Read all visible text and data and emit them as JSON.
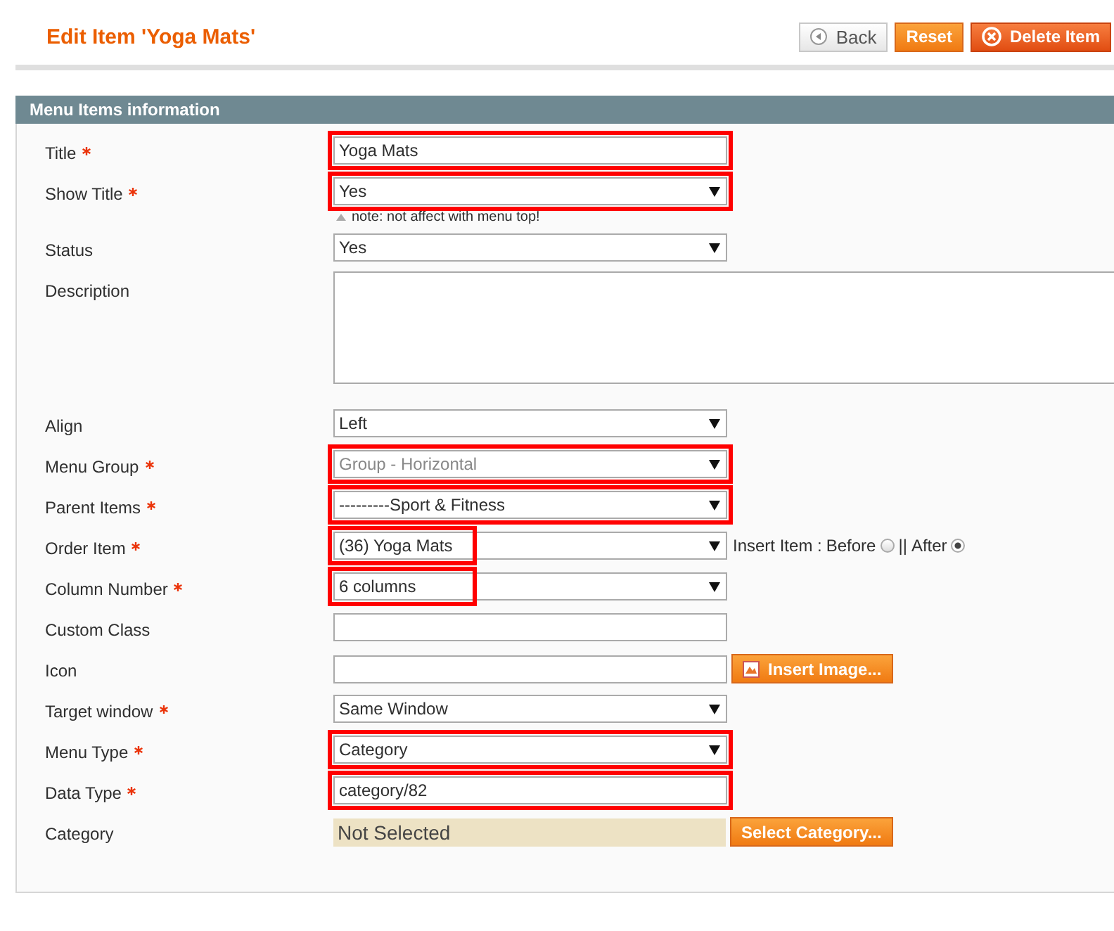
{
  "page_title": "Edit Item 'Yoga Mats'",
  "header_buttons": [
    {
      "label": "Back",
      "kind": "back"
    },
    {
      "label": "Reset",
      "kind": "primary"
    },
    {
      "label": "Delete Item",
      "kind": "delete"
    }
  ],
  "section": {
    "title": "Menu Items information"
  },
  "fields": [
    {
      "label": "Title",
      "required": true,
      "kind": "text",
      "value": "Yoga Mats",
      "highlighted": true
    },
    {
      "label": "Show Title",
      "required": true,
      "kind": "select",
      "value": "Yes",
      "highlighted": true,
      "note": "note: not affect with menu top!"
    },
    {
      "label": "Status",
      "required": false,
      "kind": "select",
      "value": "Yes"
    },
    {
      "label": "Description",
      "required": false,
      "kind": "textarea"
    },
    {
      "label": "Align",
      "required": false,
      "kind": "select",
      "value": "Left"
    },
    {
      "label": "Menu Group",
      "required": true,
      "kind": "select",
      "value": "Group - Horizontal",
      "disabled": true,
      "highlighted": true
    },
    {
      "label": "Parent Items",
      "required": true,
      "kind": "select",
      "value": "---------Sport & Fitness",
      "highlighted": true
    },
    {
      "label": "Order Item",
      "required": true,
      "kind": "select",
      "value": "(36) Yoga Mats",
      "highlighted": true,
      "value_only": true,
      "insert": {
        "prefix": "Insert Item :",
        "separator": "||",
        "options": [
          {
            "label": "Before",
            "selected": false
          },
          {
            "label": "After",
            "selected": true
          }
        ]
      }
    },
    {
      "label": "Column Number",
      "required": true,
      "kind": "select",
      "value": "6 columns",
      "highlighted": true,
      "value_only": true
    },
    {
      "label": "Custom Class",
      "required": false,
      "kind": "text"
    },
    {
      "label": "Icon",
      "required": false,
      "kind": "text",
      "button": "Insert Image..."
    },
    {
      "label": "Target window",
      "required": true,
      "kind": "select",
      "value": "Same Window"
    },
    {
      "label": "Menu Type",
      "required": true,
      "kind": "select",
      "value": "Category",
      "highlighted": true
    },
    {
      "label": "Data Type",
      "required": true,
      "kind": "text",
      "value": "category/82",
      "highlighted": true
    },
    {
      "label": "Category",
      "required": false,
      "kind": "chooser",
      "value": "Not Selected",
      "button": "Select Category..."
    }
  ]
}
